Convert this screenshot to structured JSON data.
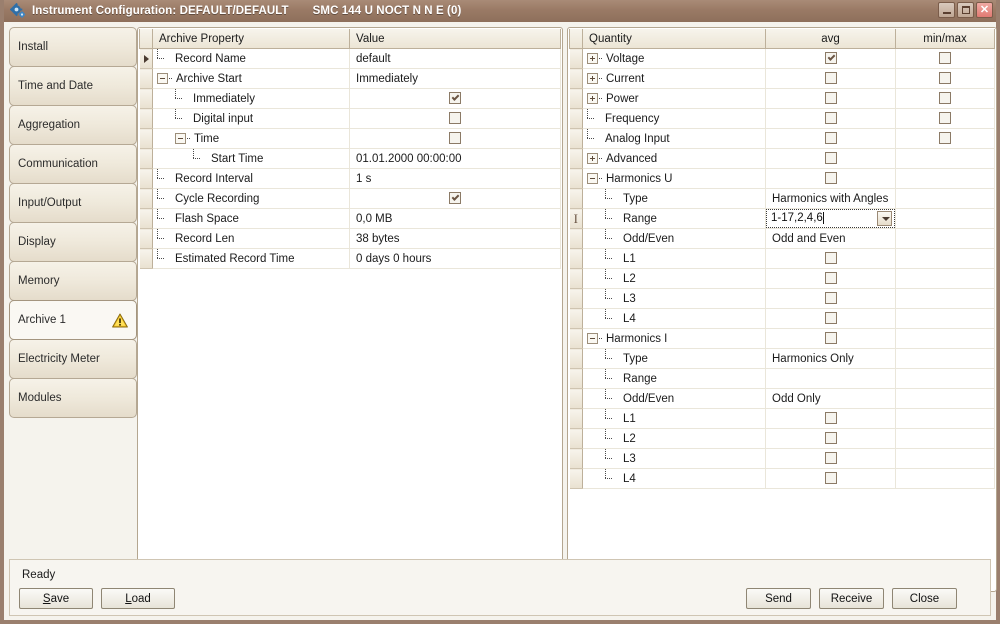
{
  "window": {
    "title": "Instrument Configuration: DEFAULT/DEFAULT",
    "subtitle": "SMC 144 U NOCT N N E (0)",
    "icon": "gear-icon",
    "minimize_label": "_",
    "maximize_label": "□",
    "close_label": "✕",
    "titlebar_color": "#9a7a65"
  },
  "sidebar": {
    "items": [
      {
        "label": "Install",
        "selected": false,
        "warning": false
      },
      {
        "label": "Time and Date",
        "selected": false,
        "warning": false
      },
      {
        "label": "Aggregation",
        "selected": false,
        "warning": false
      },
      {
        "label": "Communication",
        "selected": false,
        "warning": false
      },
      {
        "label": "Input/Output",
        "selected": false,
        "warning": false
      },
      {
        "label": "Display",
        "selected": false,
        "warning": false
      },
      {
        "label": "Memory",
        "selected": false,
        "warning": false
      },
      {
        "label": "Archive 1",
        "selected": true,
        "warning": true
      },
      {
        "label": "Electricity Meter",
        "selected": false,
        "warning": false
      },
      {
        "label": "Modules",
        "selected": false,
        "warning": false
      }
    ]
  },
  "left_grid": {
    "columns": [
      "Archive Property",
      "Value"
    ],
    "rows": [
      {
        "marker": "arrow",
        "depth": 1,
        "expander": "",
        "label": "Record Name",
        "value": "default",
        "checkbox": null
      },
      {
        "marker": "",
        "depth": 1,
        "expander": "minus",
        "label": "Archive Start",
        "value": "Immediately",
        "checkbox": null
      },
      {
        "marker": "",
        "depth": 2,
        "expander": "",
        "label": "Immediately",
        "value": "",
        "checkbox": true
      },
      {
        "marker": "",
        "depth": 2,
        "expander": "",
        "label": "Digital input",
        "value": "",
        "checkbox": false
      },
      {
        "marker": "",
        "depth": 2,
        "expander": "minus",
        "label": "Time",
        "value": "",
        "checkbox": false
      },
      {
        "marker": "",
        "depth": 3,
        "expander": "",
        "label": "Start Time",
        "value": "01.01.2000 00:00:00",
        "checkbox": null
      },
      {
        "marker": "",
        "depth": 1,
        "expander": "",
        "label": "Record Interval",
        "value": "1 s",
        "checkbox": null
      },
      {
        "marker": "",
        "depth": 1,
        "expander": "",
        "label": "Cycle Recording",
        "value": "",
        "checkbox": true
      },
      {
        "marker": "",
        "depth": 1,
        "expander": "",
        "label": "Flash Space",
        "value": "0,0 MB",
        "checkbox": null
      },
      {
        "marker": "",
        "depth": 1,
        "expander": "",
        "label": "Record Len",
        "value": "38 bytes",
        "checkbox": null
      },
      {
        "marker": "",
        "depth": 1,
        "expander": "",
        "label": "Estimated Record Time",
        "value": "0 days 0 hours",
        "checkbox": null
      }
    ]
  },
  "right_grid": {
    "columns": [
      "Quantity",
      "avg",
      "min/max"
    ],
    "rows": [
      {
        "marker": "",
        "depth": 1,
        "expander": "plus",
        "label": "Voltage",
        "avg": true,
        "minmax": false,
        "value": null
      },
      {
        "marker": "",
        "depth": 1,
        "expander": "plus",
        "label": "Current",
        "avg": false,
        "minmax": false,
        "value": null
      },
      {
        "marker": "",
        "depth": 1,
        "expander": "plus",
        "label": "Power",
        "avg": false,
        "minmax": false,
        "value": null
      },
      {
        "marker": "",
        "depth": 1,
        "expander": "",
        "label": "Frequency",
        "avg": false,
        "minmax": false,
        "value": null
      },
      {
        "marker": "",
        "depth": 1,
        "expander": "",
        "label": "Analog Input",
        "avg": false,
        "minmax": false,
        "value": null
      },
      {
        "marker": "",
        "depth": 1,
        "expander": "plus",
        "label": "Advanced",
        "avg": false,
        "minmax": null,
        "value": null
      },
      {
        "marker": "",
        "depth": 1,
        "expander": "minus",
        "label": "Harmonics U",
        "avg": false,
        "minmax": null,
        "value": null
      },
      {
        "marker": "",
        "depth": 2,
        "expander": "",
        "label": "Type",
        "avg": null,
        "minmax": null,
        "value": "Harmonics with Angles"
      },
      {
        "marker": "ibeam",
        "depth": 2,
        "expander": "",
        "label": "Range",
        "avg": null,
        "minmax": null,
        "value": "1-17,2,4,6",
        "editing": true
      },
      {
        "marker": "",
        "depth": 2,
        "expander": "",
        "label": "Odd/Even",
        "avg": null,
        "minmax": null,
        "value": "Odd and Even"
      },
      {
        "marker": "",
        "depth": 2,
        "expander": "",
        "label": "L1",
        "avg": false,
        "minmax": null,
        "value": null
      },
      {
        "marker": "",
        "depth": 2,
        "expander": "",
        "label": "L2",
        "avg": false,
        "minmax": null,
        "value": null
      },
      {
        "marker": "",
        "depth": 2,
        "expander": "",
        "label": "L3",
        "avg": false,
        "minmax": null,
        "value": null
      },
      {
        "marker": "",
        "depth": 2,
        "expander": "",
        "label": "L4",
        "avg": false,
        "minmax": null,
        "value": null
      },
      {
        "marker": "",
        "depth": 1,
        "expander": "minus",
        "label": "Harmonics I",
        "avg": false,
        "minmax": null,
        "value": null
      },
      {
        "marker": "",
        "depth": 2,
        "expander": "",
        "label": "Type",
        "avg": null,
        "minmax": null,
        "value": "Harmonics Only"
      },
      {
        "marker": "",
        "depth": 2,
        "expander": "",
        "label": "Range",
        "avg": null,
        "minmax": null,
        "value": ""
      },
      {
        "marker": "",
        "depth": 2,
        "expander": "",
        "label": "Odd/Even",
        "avg": null,
        "minmax": null,
        "value": "Odd Only"
      },
      {
        "marker": "",
        "depth": 2,
        "expander": "",
        "label": "L1",
        "avg": false,
        "minmax": null,
        "value": null
      },
      {
        "marker": "",
        "depth": 2,
        "expander": "",
        "label": "L2",
        "avg": false,
        "minmax": null,
        "value": null
      },
      {
        "marker": "",
        "depth": 2,
        "expander": "",
        "label": "L3",
        "avg": false,
        "minmax": null,
        "value": null
      },
      {
        "marker": "",
        "depth": 2,
        "expander": "",
        "label": "L4",
        "avg": false,
        "minmax": null,
        "value": null
      }
    ]
  },
  "statusbar": {
    "status": "Ready",
    "save": {
      "pre": "",
      "accel": "S",
      "post": "ave"
    },
    "load": {
      "pre": "",
      "accel": "L",
      "post": "oad"
    },
    "send": "Send",
    "receive": "Receive",
    "close": "Close"
  }
}
